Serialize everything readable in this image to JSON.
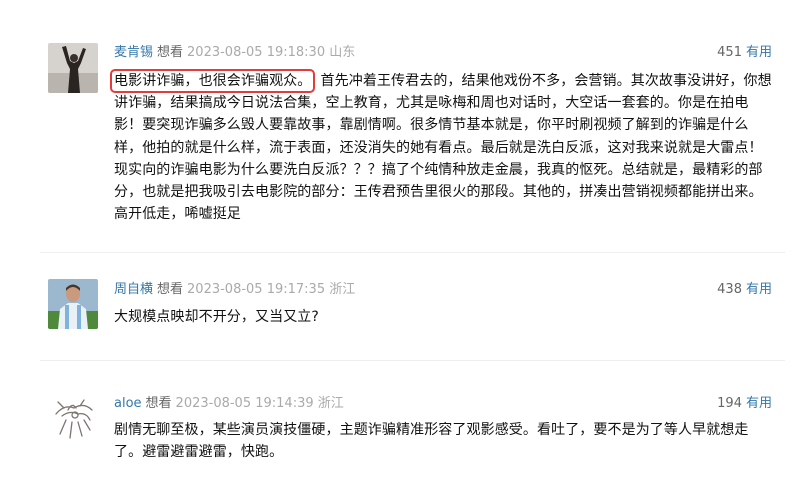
{
  "comments": [
    {
      "user": "麦肯锡",
      "rating": "想看",
      "time": "2023-08-05 19:18:30",
      "location": "山东",
      "votes": "451",
      "useful_label": "有用",
      "highlight": "电影讲诈骗，也很会诈骗观众。",
      "text": "首先冲着王传君去的，结果他戏份不多，会营销。其次故事没讲好，你想讲诈骗，结果搞成今日说法合集，空上教育，尤其是咏梅和周也对话时，大空话一套套的。你是在拍电影！要突现诈骗多么毁人要靠故事，靠剧情啊。很多情节基本就是，你平时刷视频了解到的诈骗是什么样，他拍的就是什么样，流于表面，还没消失的她有看点。最后就是洗白反派，这对我来说就是大雷点！现实向的诈骗电影为什么要洗白反派？？？搞了个纯情种放走金晨，我真的怄死。总结就是，最精彩的部分，也就是把我吸引去电影院的部分：王传君预告里很火的那段。其他的，拼凑出营销视频都能拼出来。高开低走，唏嘘挺足",
      "avatar_icon": "raised-arms-figure"
    },
    {
      "user": "周自横",
      "rating": "想看",
      "time": "2023-08-05 19:17:35",
      "location": "浙江",
      "votes": "438",
      "useful_label": "有用",
      "text": "大规模点映却不开分，又当又立?",
      "avatar_icon": "footballer-photo"
    },
    {
      "user": "aloe",
      "rating": "想看",
      "time": "2023-08-05 19:14:39",
      "location": "浙江",
      "votes": "194",
      "useful_label": "有用",
      "text": "剧情无聊至极，某些演员演技僵硬，主题诈骗精准形容了观影感受。看吐了，要不是为了等人早就想走了。避雷避雷避雷，快跑。",
      "avatar_icon": "sketch-creature"
    }
  ]
}
